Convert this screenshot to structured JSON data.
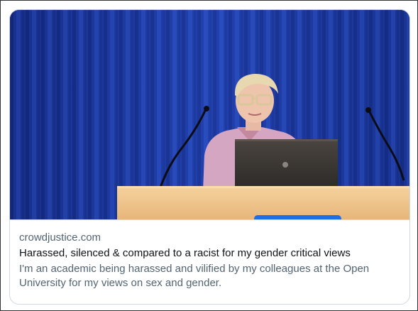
{
  "link_card": {
    "domain": "crowdjustice.com",
    "title": "Harassed, silenced & compared to a racist for my gender critical views",
    "description": "I'm an academic being harassed and vilified by my colleagues at the Open University for my views on sex and gender."
  },
  "colors": {
    "curtain": "#1e3a9e",
    "lectern": "#f2c890",
    "laptop": "#3a3632",
    "card_border": "#cfd9de",
    "text_primary": "#0f1419",
    "text_secondary": "#536471"
  },
  "icons": {
    "laptop_logo": "hp-logo-icon"
  }
}
